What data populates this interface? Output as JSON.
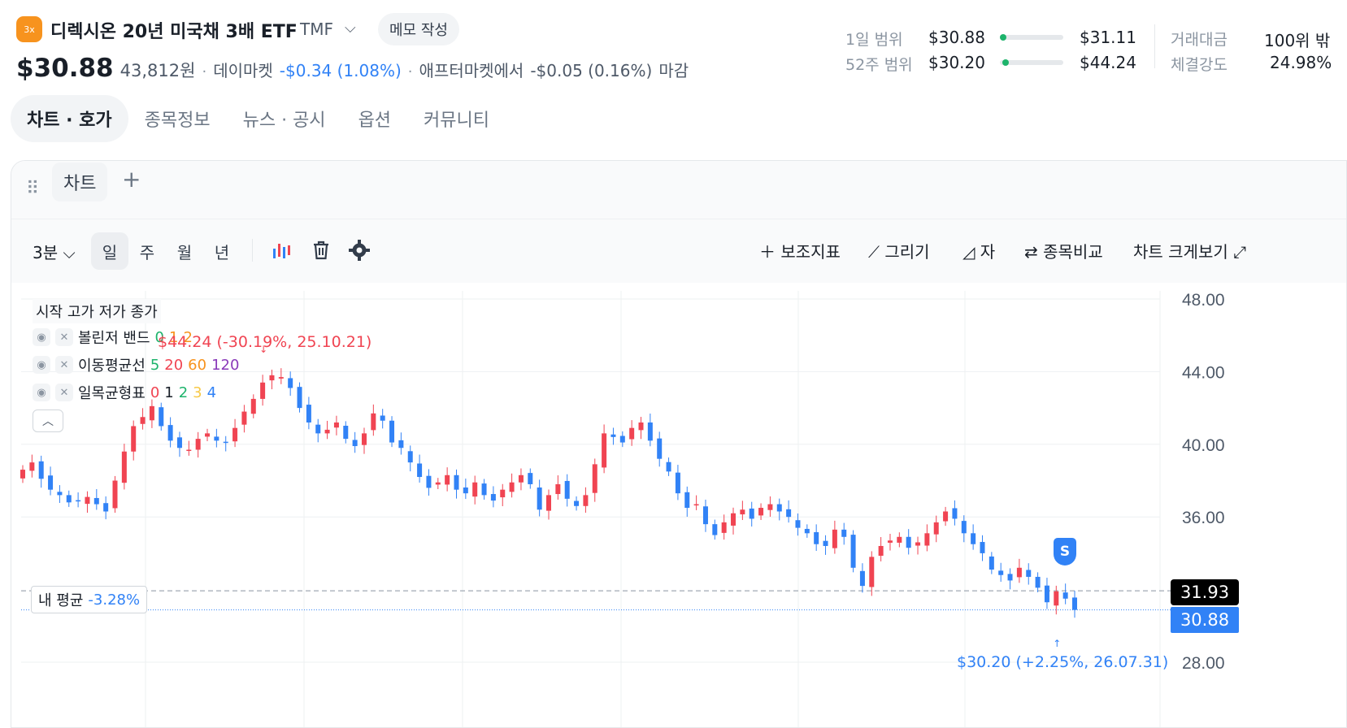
{
  "header": {
    "badge": "3x",
    "title": "디렉시온 20년 미국채 3배 ETF",
    "ticker": "TMF",
    "memo_button": "메모 작성",
    "price": "$30.88",
    "price_krw": "43,812원",
    "market_label": "데이마켓",
    "change": "-$0.34 (1.08%)",
    "after_label": "애프터마켓에서",
    "after_change": "-$0.05 (0.16%)",
    "after_suffix": "마감"
  },
  "ranges": {
    "day_label": "1일 범위",
    "day_low": "$30.88",
    "day_high": "$31.11",
    "week52_label": "52주 범위",
    "week52_low": "$30.20",
    "week52_high": "$44.24",
    "volume_label": "거래대금",
    "volume_value": "100위 밖",
    "strength_label": "체결강도",
    "strength_value": "24.98%"
  },
  "tabs": [
    "차트 · 호가",
    "종목정보",
    "뉴스 · 공시",
    "옵션",
    "커뮤니티"
  ],
  "panel": {
    "chart_tab": "차트"
  },
  "toolbar": {
    "interval": "3분",
    "periods": [
      "일",
      "주",
      "월",
      "년"
    ],
    "indicator": "보조지표",
    "draw": "그리기",
    "ruler": "자",
    "compare": "종목비교",
    "expand": "차트 크게보기"
  },
  "legend": {
    "ohlc": "시작 고가 저가 종가",
    "bollinger": "볼린저 밴드",
    "bollinger_params": [
      "0",
      "1",
      "2"
    ],
    "ma": "이동평균선",
    "ma_params": [
      "5",
      "20",
      "60",
      "120"
    ],
    "ichimoku": "일목균형표",
    "ichimoku_params": [
      "0",
      "1",
      "2",
      "3",
      "4"
    ]
  },
  "annotations": {
    "high": "$44.24 (-30.19%, 25.10.21)",
    "low": "$30.20 (+2.25%, 26.07.31)",
    "my_avg_label": "내 평균",
    "my_avg_pct": "-3.28%",
    "avg_price_tag": "31.93",
    "current_price_tag": "30.88",
    "sell_marker": "S"
  },
  "colors": {
    "up": "#f04452",
    "down": "#3182f6",
    "accent": "#3182f6",
    "badge": "#f7931e"
  },
  "chart_data": {
    "type": "candlestick",
    "title": "",
    "xlabel": "",
    "ylabel": "",
    "ylim": [
      27,
      49
    ],
    "y_ticks": [
      "48.00",
      "44.00",
      "40.00",
      "36.00",
      "28.00"
    ],
    "close": [
      38.6,
      39.0,
      38.1,
      37.5,
      37.2,
      36.8,
      36.9,
      37.1,
      36.7,
      36.3,
      38.0,
      39.6,
      41.0,
      41.5,
      42.1,
      41.0,
      40.2,
      39.8,
      39.7,
      40.3,
      40.6,
      40.2,
      40.1,
      40.9,
      41.8,
      42.5,
      43.4,
      43.8,
      43.7,
      43.1,
      42.0,
      41.2,
      40.6,
      40.8,
      41.2,
      40.3,
      39.9,
      40.6,
      41.7,
      41.3,
      40.1,
      39.8,
      39.0,
      38.2,
      37.6,
      37.9,
      38.3,
      37.5,
      37.3,
      37.9,
      37.2,
      36.9,
      37.5,
      37.9,
      38.3,
      37.8,
      36.4,
      37.2,
      37.8,
      37.0,
      36.6,
      37.2,
      38.9,
      40.6,
      40.4,
      40.1,
      40.9,
      41.2,
      40.2,
      39.2,
      38.5,
      37.3,
      36.5,
      36.7,
      35.6,
      35.0,
      35.7,
      36.2,
      36.4,
      35.9,
      36.5,
      36.7,
      36.3,
      36.0,
      35.4,
      35.1,
      34.5,
      34.4,
      35.3,
      34.9,
      33.2,
      32.2,
      33.8,
      34.4,
      34.7,
      34.9,
      34.3,
      34.6,
      35.1,
      35.7,
      36.3,
      35.9,
      35.1,
      34.5,
      34.0,
      33.1,
      32.8,
      32.5,
      33.2,
      32.7,
      32.1,
      31.3,
      31.9,
      31.5,
      30.88
    ],
    "period_high": 44.24,
    "period_low": 30.2,
    "my_average": 31.93,
    "current": 30.88
  }
}
